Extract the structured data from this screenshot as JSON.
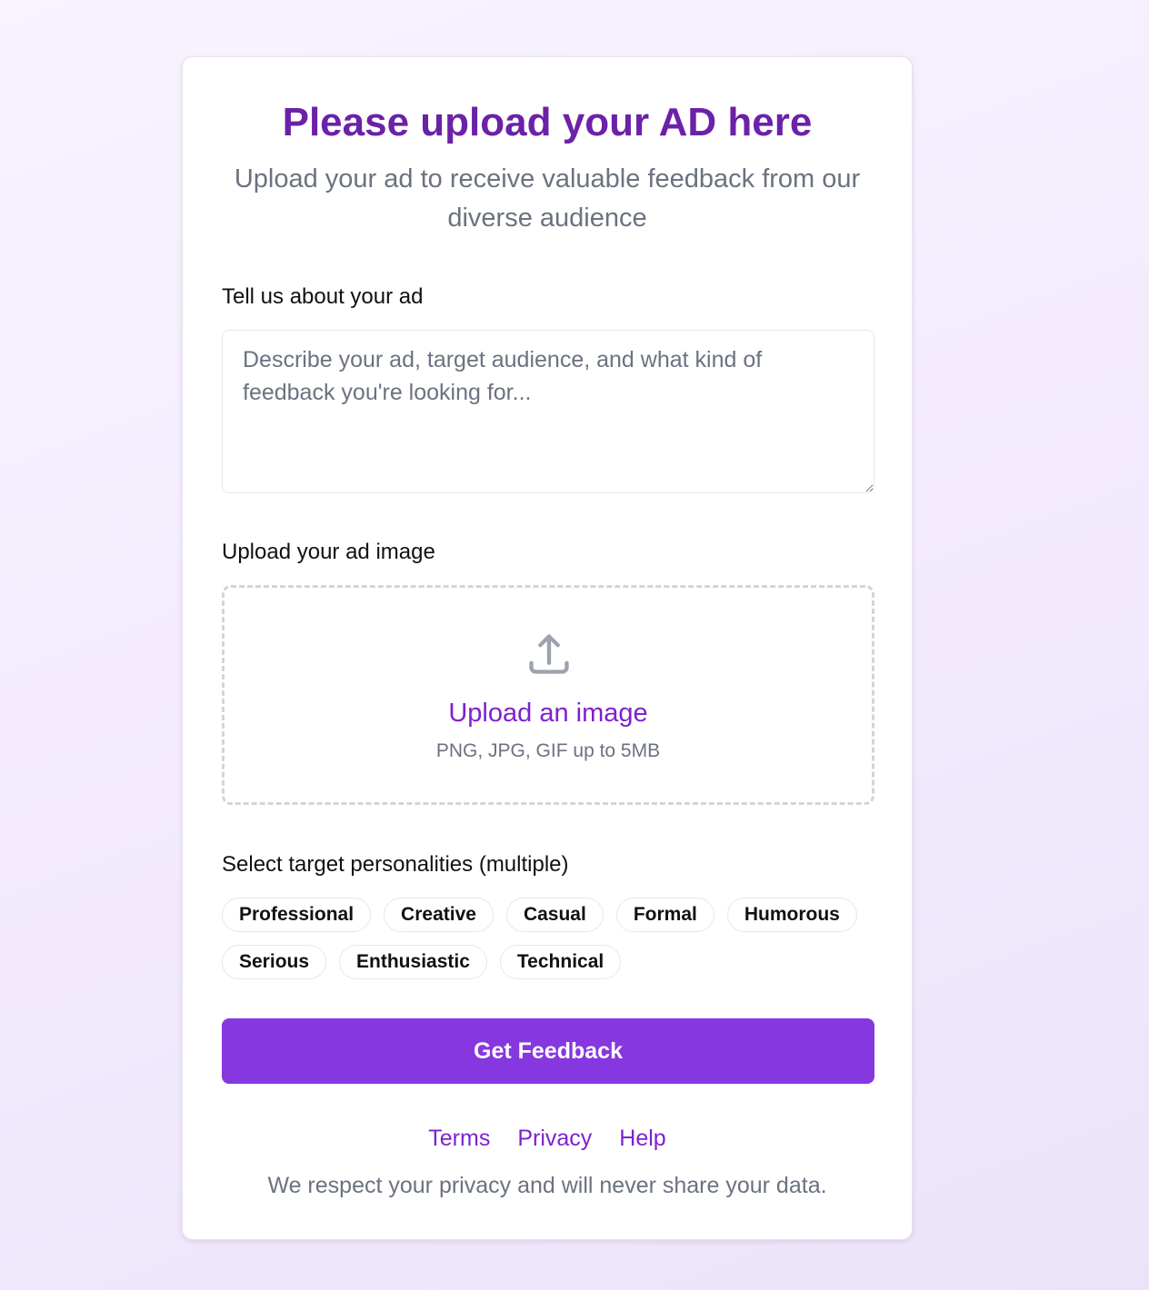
{
  "header": {
    "title": "Please upload your AD here",
    "subtitle": "Upload your ad to receive valuable feedback from our diverse audience"
  },
  "description": {
    "label": "Tell us about your ad",
    "value": "",
    "placeholder": "Describe your ad, target audience, and what kind of feedback you're looking for..."
  },
  "upload": {
    "label": "Upload your ad image",
    "icon": "upload-icon",
    "link_text": "Upload an image",
    "hint": "PNG, JPG, GIF up to 5MB"
  },
  "personalities": {
    "label": "Select target personalities (multiple)",
    "options": [
      "Professional",
      "Creative",
      "Casual",
      "Formal",
      "Humorous",
      "Serious",
      "Enthusiastic",
      "Technical"
    ]
  },
  "submit": {
    "label": "Get Feedback"
  },
  "footer": {
    "links": [
      "Terms",
      "Privacy",
      "Help"
    ],
    "note": "We respect your privacy and will never share your data."
  },
  "colors": {
    "accent": "#8637e0",
    "title": "#6b21a8",
    "muted_text": "#6b7280"
  }
}
